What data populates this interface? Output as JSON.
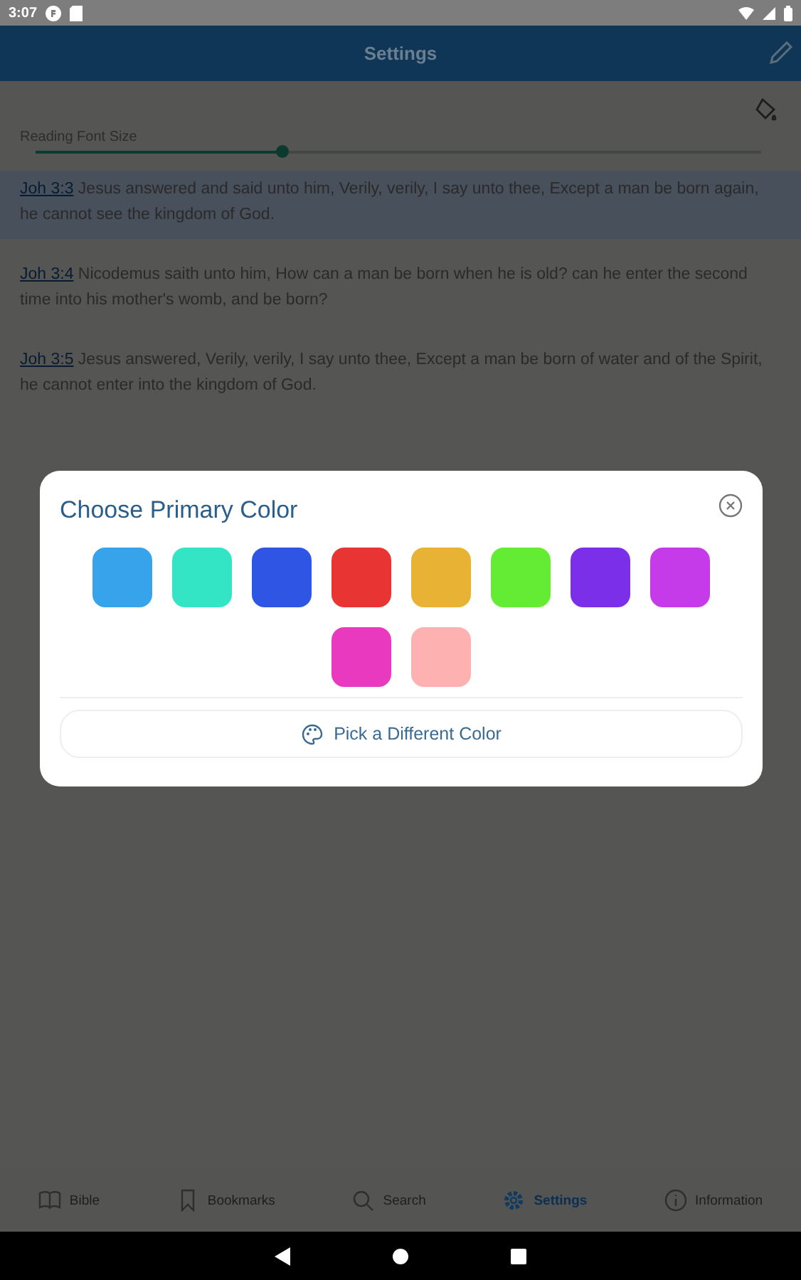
{
  "status_bar": {
    "time": "3:07"
  },
  "app_bar": {
    "title": "Settings"
  },
  "font_size": {
    "label": "Reading Font Size",
    "level": 0.34
  },
  "verses": [
    {
      "ref": "Joh 3:3",
      "text": "Jesus answered and said unto him, Verily, verily, I say unto thee, Except a man be born again, he cannot see the kingdom of God.",
      "selected": true
    },
    {
      "ref": "Joh 3:4",
      "text": "Nicodemus saith unto him, How can a man be born when he is old? can he enter the second time into his mother's womb, and be born?",
      "selected": false
    },
    {
      "ref": "Joh 3:5",
      "text": "Jesus answered, Verily, verily, I say unto thee, Except a man be born of water and of the Spirit, he cannot enter into the kingdom of God.",
      "selected": false
    }
  ],
  "dialog": {
    "title": "Choose Primary Color",
    "swatches": [
      {
        "color": "#36a3ea"
      },
      {
        "color": "#33e5c4"
      },
      {
        "color": "#2e55e4"
      },
      {
        "color": "#e93434"
      },
      {
        "color": "#e8b334"
      },
      {
        "color": "#64eb34"
      },
      {
        "color": "#7b2fe8"
      },
      {
        "color": "#c53be9"
      },
      {
        "color": "#e93abf"
      },
      {
        "color": "#fdb1b1"
      }
    ],
    "button": "Pick a Different Color"
  },
  "bottom_nav": [
    {
      "label": "Bible",
      "selected": false
    },
    {
      "label": "Bookmarks",
      "selected": false
    },
    {
      "label": "Search",
      "selected": false
    },
    {
      "label": "Settings",
      "selected": true
    },
    {
      "label": "Information",
      "selected": false
    }
  ]
}
